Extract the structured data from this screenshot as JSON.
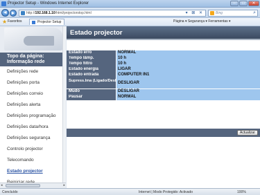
{
  "window": {
    "title": "Projector Setup - Windows Internet Explorer",
    "minimize_label": "–",
    "maximize_label": "□",
    "close_label": "✕"
  },
  "address": {
    "url_prefix": "http://",
    "url_host": "192.168.1.10",
    "url_path": "/html/projectorstop.html",
    "search_placeholder": "Bing",
    "back_label": "◄",
    "forward_label": "►",
    "tools": "▾ ⊠ ✕",
    "search_icon": "⌕"
  },
  "favorites": {
    "label": "Favoritos",
    "tab_label": "Projector Setup",
    "commands": "Página ▾  Segurança ▾  Ferramentas ▾"
  },
  "sidebar": {
    "top_label": "Topo da página: Informação rede",
    "items": [
      {
        "label": "Definições rede"
      },
      {
        "label": "Definições porta"
      },
      {
        "label": "Definições correio"
      },
      {
        "label": "Definições alerta"
      },
      {
        "label": "Definições programação"
      },
      {
        "label": "Definições data/hora"
      },
      {
        "label": "Definições segurança"
      },
      {
        "label": "Controlo projector"
      },
      {
        "label": "Telecomando"
      },
      {
        "label": "Estado projector"
      },
      {
        "label": "Reiniciar rede"
      }
    ]
  },
  "main": {
    "title": "Estado projector",
    "rows": [
      {
        "key": "Estado erro",
        "value": "NORMAL"
      },
      {
        "key": "Tempo lâmp.",
        "value": "10 h"
      },
      {
        "key": "Tempo filtro",
        "value": "10 h"
      },
      {
        "key": "Estado energia",
        "value": "LIGAR"
      },
      {
        "key": "Estado entrada",
        "value": "COMPUTER IN1"
      },
      {
        "key": "Supress.Ima (Ligado/Desligado)",
        "value": "DESLIGAR"
      },
      {
        "key": "Mudo",
        "value": "DESLIGAR"
      },
      {
        "key": "Pausar",
        "value": "NORMAL"
      }
    ],
    "refresh_label": "Actualizar"
  },
  "statusbar": {
    "left": "Concluído",
    "middle": "Internet | Modo Protegido: Activado",
    "zoom": "100%"
  },
  "colors": {
    "header": "#4a5a72",
    "key_cell": "#55657e",
    "value_cell": "#9ec6ee",
    "active_link": "#2952a3"
  }
}
